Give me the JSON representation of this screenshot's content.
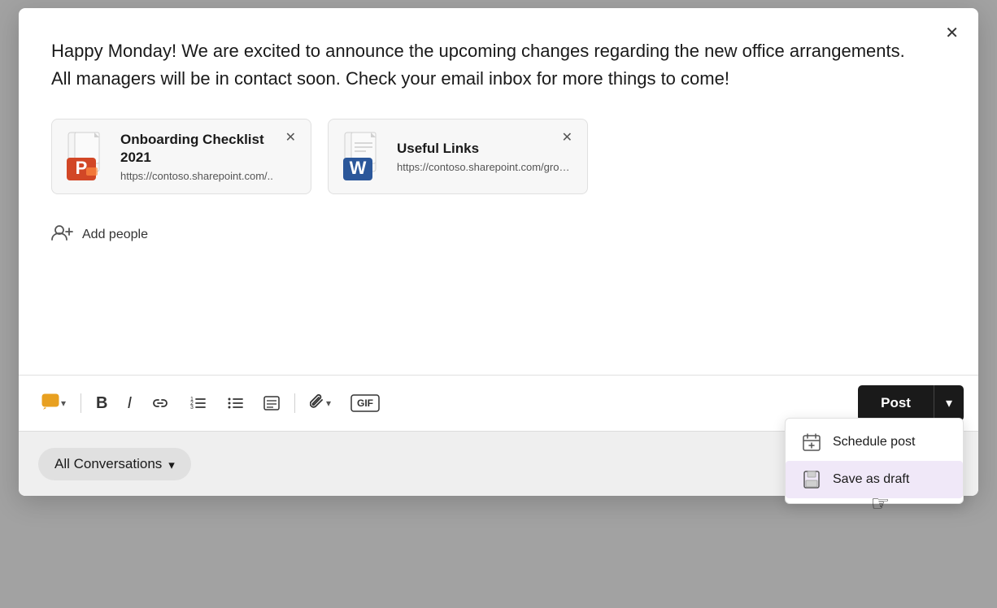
{
  "modal": {
    "close_label": "✕",
    "message": "Happy Monday! We are excited to announce the upcoming changes regarding the new office arrangements. All managers will be in contact soon. Check your email inbox for more things to come!"
  },
  "attachments": [
    {
      "id": "ppt",
      "title": "Onboarding Checklist 2021",
      "url": "https://contoso.sharepoint.com/..",
      "type": "powerpoint"
    },
    {
      "id": "word",
      "title": "Useful Links",
      "url": "https://contoso.sharepoint.com/groups/contosonewemployees/...",
      "type": "word"
    }
  ],
  "add_people": {
    "label": "Add people"
  },
  "toolbar": {
    "message_type_label": "💬",
    "bold_label": "B",
    "italic_label": "I",
    "post_label": "Post"
  },
  "dropdown": {
    "schedule_label": "Schedule post",
    "save_draft_label": "Save as draft"
  },
  "bottom": {
    "all_conversations_label": "All Conversations",
    "chevron_label": "⌄"
  }
}
